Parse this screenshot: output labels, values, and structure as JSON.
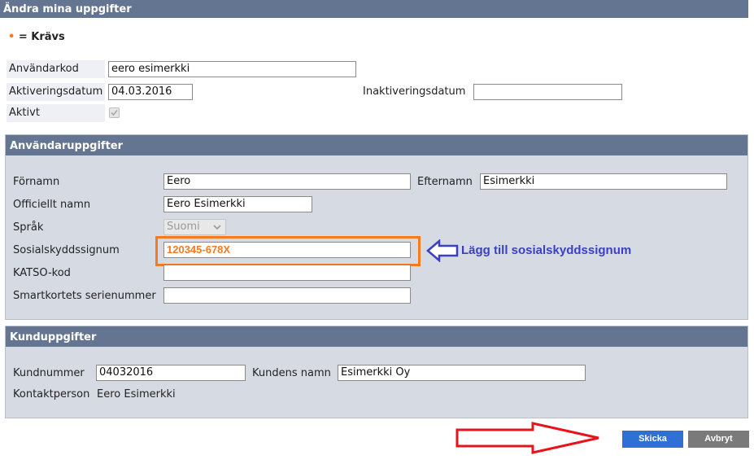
{
  "header": {
    "title": "Ändra mina uppgifter"
  },
  "required_note": {
    "bullet": "•",
    "text": "= Krävs"
  },
  "top": {
    "username": {
      "label": "Användarkod",
      "value": "eero esimerkki"
    },
    "activation": {
      "label": "Aktiveringsdatum",
      "value": "04.03.2016"
    },
    "inactivation": {
      "label": "Inaktiveringsdatum",
      "value": ""
    },
    "active": {
      "label": "Aktivt",
      "checked": true
    }
  },
  "user_section": {
    "title": "Användaruppgifter",
    "firstname": {
      "label": "Förnamn",
      "value": "Eero"
    },
    "lastname": {
      "label": "Efternamn",
      "value": "Esimerkki"
    },
    "official_name": {
      "label": "Officiellt namn",
      "value": "Eero Esimerkki"
    },
    "language": {
      "label": "Språk",
      "value": "Suomi"
    },
    "ssn": {
      "label": "Sosialskyddssignum",
      "value": "120345-678X"
    },
    "katso": {
      "label": "KATSO-kod",
      "value": ""
    },
    "smartcard": {
      "label": "Smartkortets serienummer",
      "value": ""
    },
    "annotation": "Lägg till sosialskyddssignum"
  },
  "customer_section": {
    "title": "Kunduppgifter",
    "number": {
      "label": "Kundnummer",
      "value": "04032016"
    },
    "name": {
      "label": "Kundens namn",
      "value": "Esimerkki Oy"
    },
    "contact": {
      "label": "Kontaktperson",
      "value": "Eero Esimerkki"
    }
  },
  "buttons": {
    "submit": "Skicka",
    "cancel": "Avbryt"
  },
  "colors": {
    "header_bg": "#647592",
    "highlight_orange": "#f47b20",
    "annotation_blue": "#3a3fc4",
    "arrow_red": "#e8141b",
    "submit_bg": "#2f6fd6",
    "cancel_bg": "#7a7a7a"
  }
}
